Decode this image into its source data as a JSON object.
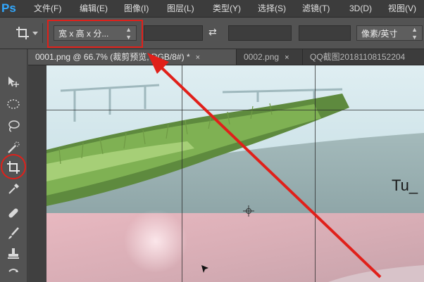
{
  "app": {
    "logo": "Ps"
  },
  "menu": [
    "文件(F)",
    "编辑(E)",
    "图像(I)",
    "图层(L)",
    "类型(Y)",
    "选择(S)",
    "滤镜(T)",
    "3D(D)",
    "视图(V)"
  ],
  "options_bar": {
    "tool_icon": "crop-icon",
    "ratio_preset": "宽 x 高 x 分...",
    "swap_icon": "swap-arrows-icon",
    "unit": "像素/英寸"
  },
  "tools": [
    "move-icon",
    "ellipse-marquee-icon",
    "lasso-icon",
    "quick-selection-icon",
    "crop-icon",
    "eyedropper-icon",
    "spot-healing-icon",
    "brush-icon",
    "clone-stamp-icon",
    "history-brush-icon"
  ],
  "tabs": [
    {
      "label": "0001.png @ 66.7% (裁剪预览, RGB/8#) *",
      "active": true,
      "close": "×"
    },
    {
      "label": "0002.png",
      "active": false,
      "close": "×"
    },
    {
      "label": "QQ截图20181108152204",
      "active": false,
      "close": ""
    }
  ],
  "canvas": {
    "overlay_text": "Tu_"
  },
  "colors": {
    "annotation_red": "#e0201a",
    "accent": "#31a8ff"
  }
}
